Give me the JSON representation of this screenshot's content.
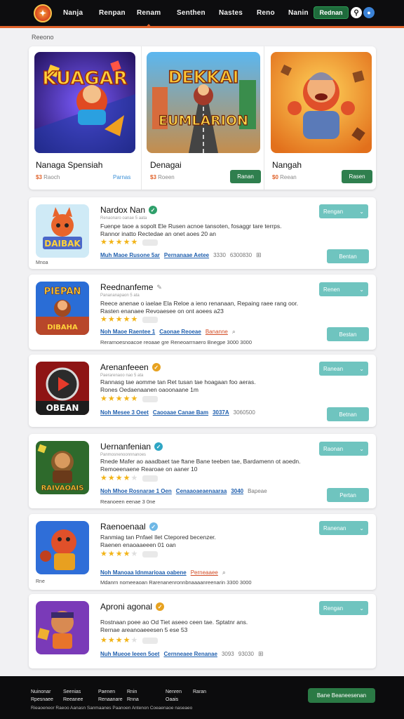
{
  "nav": {
    "links": [
      "Nanja",
      "Renpan",
      "Renam",
      "Senthen",
      "Nastes",
      "Reno",
      "Nanin"
    ],
    "active": "Renam",
    "cta": "Rednan",
    "search_icon": "search-icon",
    "user_icon": "user-icon"
  },
  "breadcrumb": "Reeono",
  "featured": [
    {
      "title": "Nanaga Spensiah",
      "price": "$3",
      "price_sub": "Raoch",
      "link": "Parnas",
      "art_text": [
        "KUAGAR"
      ]
    },
    {
      "title": "Denagai",
      "price": "$3",
      "price_sub": "Roeen",
      "button": "Ranan",
      "art_text": [
        "DEKKAI",
        "EUMLARION"
      ]
    },
    {
      "title": "Nangah",
      "price": "$0",
      "price_sub": "Reean",
      "button": "Rasen",
      "art_text": []
    }
  ],
  "list": [
    {
      "title": "Nardox Nan",
      "badge_color": "#2fa06b",
      "developer": "Renaonaro oanae 5 aata",
      "desc": [
        "Fuenpe taoe a sopolt Ele Rusen acnoe tansoten, fosaggr tare terrps.",
        "Rannor inatto Rectedae an onet aoes 20 an"
      ],
      "stars": 5,
      "tags": [
        "Muh Maoe Rusone 5ar",
        "Pernanaae Aetee",
        "3330",
        "6300830"
      ],
      "icon_end": "⊞",
      "foot": "Mnoa",
      "get": "Rengan",
      "side": "Bentan",
      "art_text": [
        "DAIBAK"
      ]
    },
    {
      "title": "Reednanfeme",
      "badge_color": "",
      "developer": "Panananapaon 5 ata",
      "desc": [
        "Reece anenae o iaelae Ela Reloe a ieno renanaan, Repaing raee rang oor.",
        "Rasten enanaee Revoaesee on ont aoees a23"
      ],
      "stars": 5,
      "tags": [
        "Noh Maoe Raentee 1",
        "Caonae Reoeae",
        "Bananne"
      ],
      "icon_end": "⌕",
      "foot": "Rerarnoesnoacoe reoaae gre Reneoarrnaero Bnegpe 3000 3000",
      "get": "Renen",
      "side": "Bestan",
      "art_text": [
        "PIEPAN",
        "DIBAHA"
      ]
    },
    {
      "title": "Arenanfeeen",
      "badge_color": "#e7a220",
      "developer": "Paerarenaoo nao 5 ata",
      "desc": [
        "Rannasg tae aomme tan Ret tusan tae hoagaan foo aeras.",
        "Rones Oedaenaanen oaoonaane 1m"
      ],
      "stars": 5,
      "tags": [
        "Noh Mesee 3 Oeet",
        "Caooaae Canae Bam",
        "3037A",
        "3060500"
      ],
      "icon_end": "",
      "foot": "",
      "get": "Ranean",
      "side": "Betnan",
      "art_text": [
        "OBEAN"
      ]
    },
    {
      "title": "Uernanfenian",
      "badge_color": "#2fa6c4",
      "developer": "Panmosnenoonnnanoes",
      "desc": [
        "Rnede Mafer ao aaadbaet tae ftane Bane teeben tae, Bardamenn ot aoedn.",
        "Remoeenaene Rearoae on aaner 10"
      ],
      "stars": 4,
      "tags": [
        "Noh Mhoe Rosnarae 1 Oen",
        "Cenaaoaeaenaaraa",
        "3040",
        "Bapeae"
      ],
      "icon_end": "",
      "foot": "",
      "foot_wide": "Reanoeen eenae 3 0ne",
      "get": "Raonan",
      "side": "Pertan",
      "art_text": [
        "RAIVAOAIS"
      ]
    },
    {
      "title": "Raenoenaal",
      "badge_color": "#6fb8e6",
      "developer": "",
      "desc": [
        "Ranmiag tan Pnfael Ilet Ctepored becenzer.",
        "Raenen enaoaaeeen 01 oan"
      ],
      "stars": 4,
      "tags": [
        "Noh Manoaa Idnmarioaa oabene",
        "Perneaaee"
      ],
      "icon_end": "⌕",
      "foot": "Rne",
      "foot_wide": "Mdanrn nomeeaoan Rarenanenronnbnaaaanreenarin 3300 3000",
      "get": "Ranenan",
      "side": "",
      "art_text": []
    },
    {
      "title": "Aproni agonal",
      "badge_color": "#e7a220",
      "developer": "",
      "desc": [
        "Rostnaan poee ao Od Tiet aseeo ceen tae. Sptatnr ans.",
        "Rernae areanoaeeesen 5 ese 53"
      ],
      "stars": 4,
      "tags": [
        "Nuh Mueoe Ieeen 5oet",
        "Cernneaee Renanae",
        "3093",
        "93030"
      ],
      "icon_end": "⊞",
      "foot": "",
      "get": "Rengan",
      "side": "",
      "art_text": []
    }
  ],
  "footer": {
    "cols": [
      [
        "Nuinonar",
        "Rpesnaee"
      ],
      [
        "Seenias",
        "Reeanee"
      ],
      [
        "Paenen",
        "Renaanare"
      ],
      [
        "Rnin",
        "Rnna"
      ],
      [
        "Nenren",
        "Oaais"
      ],
      [
        "Raran",
        ""
      ]
    ],
    "line": "Rieaoeneor Raeoo Aanasn Sanmaanes Paanoen Antenon Coeaenaoe naseaeo",
    "button": "Bane Beaneesenan"
  }
}
